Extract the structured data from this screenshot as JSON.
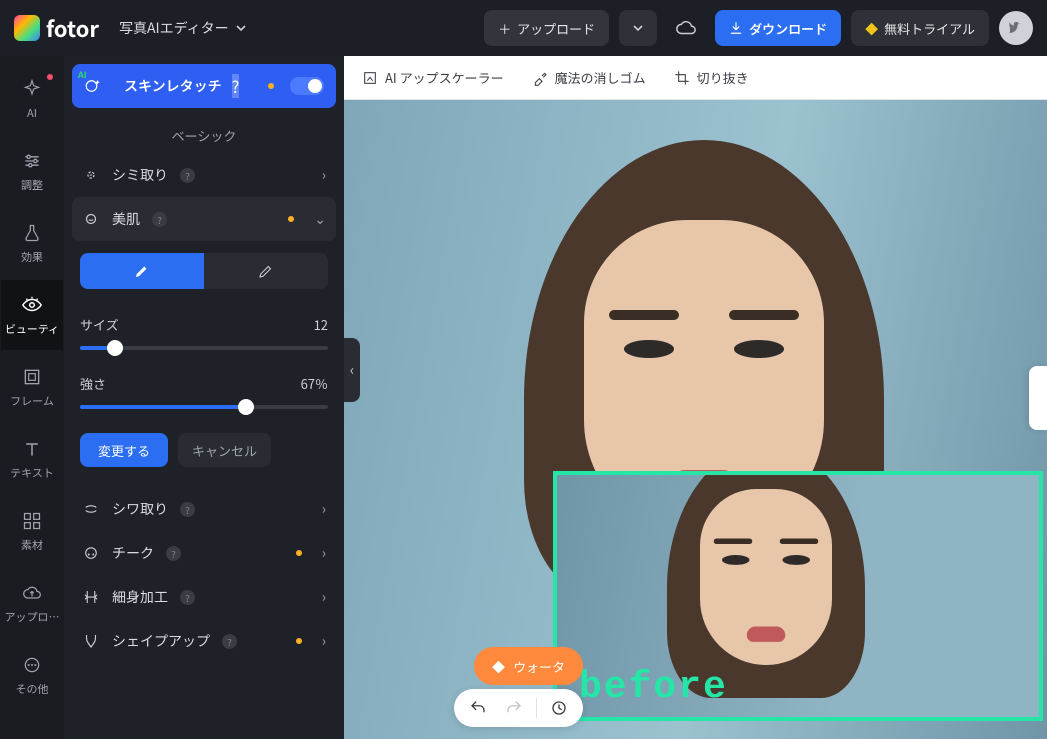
{
  "header": {
    "brand": "fotor",
    "mode": "写真AIエディター",
    "upload": "アップロード",
    "download": "ダウンロード",
    "trial": "無料トライアル"
  },
  "rail": [
    {
      "key": "ai",
      "label": "AI",
      "hasDot": true
    },
    {
      "key": "adjust",
      "label": "調整"
    },
    {
      "key": "effect",
      "label": "効果"
    },
    {
      "key": "beauty",
      "label": "ビューティ",
      "selected": true
    },
    {
      "key": "frame",
      "label": "フレーム"
    },
    {
      "key": "text",
      "label": "テキスト"
    },
    {
      "key": "material",
      "label": "素材"
    },
    {
      "key": "upload",
      "label": "アップロ…"
    },
    {
      "key": "other",
      "label": "その他"
    }
  ],
  "panel": {
    "ai_retouch_label": "スキンレタッチ",
    "group_basic": "ベーシック",
    "rows": {
      "blemish": "シミ取り",
      "smooth": "美肌",
      "wrinkle": "シワ取り",
      "cheek": "チーク",
      "slim": "細身加工",
      "shapeup": "シェイプアップ"
    },
    "size_label": "サイズ",
    "size_value": "12",
    "size_percent": 14,
    "strength_label": "強さ",
    "strength_value": "67％",
    "strength_percent": 67,
    "apply": "変更する",
    "cancel": "キャンセル"
  },
  "topbar": {
    "upscale": "AI アップスケーラー",
    "eraser": "魔法の消しゴム",
    "crop": "切り抜き"
  },
  "canvas": {
    "before_label": "before",
    "watermark": "ウォータ"
  }
}
